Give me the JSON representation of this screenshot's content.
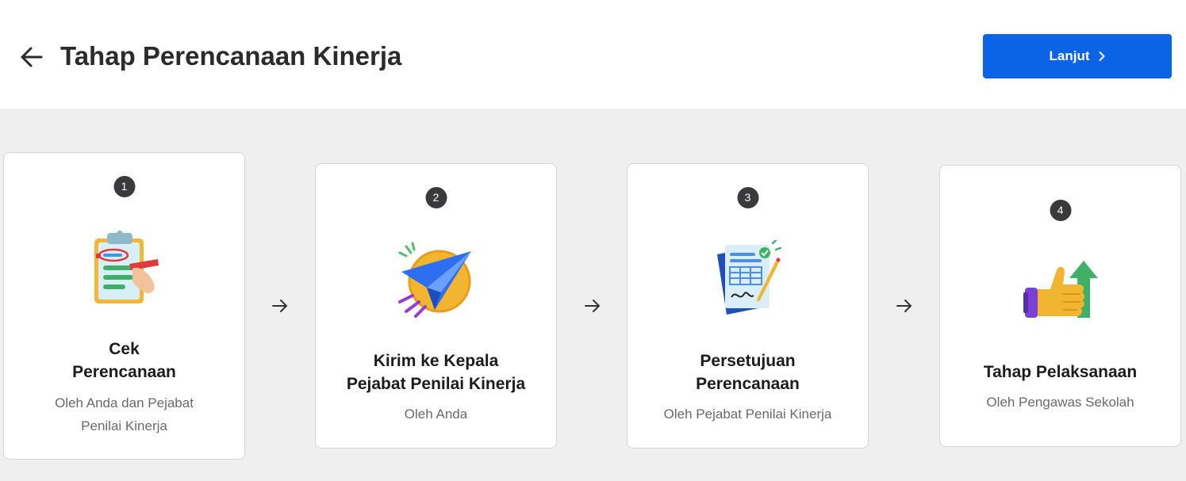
{
  "header": {
    "title": "Tahap Perencanaan Kinerja",
    "back_icon": "arrow-left-icon",
    "next_label": "Lanjut",
    "next_icon": "chevron-right-icon"
  },
  "colors": {
    "primary": "#0b63e6",
    "step_badge": "#3a3a3c",
    "background": "#efefef"
  },
  "steps": [
    {
      "number": "1",
      "title": "Cek\nPerencanaan",
      "subtitle": "Oleh Anda dan Pejabat\nPenilai Kinerja",
      "icon": "clipboard-check-icon"
    },
    {
      "number": "2",
      "title": "Kirim ke Kepala\nPejabat Penilai Kinerja",
      "subtitle": "Oleh Anda",
      "icon": "paper-plane-icon"
    },
    {
      "number": "3",
      "title": "Persetujuan\nPerencanaan",
      "subtitle": "Oleh Pejabat Penilai Kinerja",
      "icon": "signed-document-icon"
    },
    {
      "number": "4",
      "title": "Tahap Pelaksanaan",
      "subtitle": "Oleh Pengawas Sekolah",
      "icon": "thumbs-up-growth-icon"
    }
  ]
}
